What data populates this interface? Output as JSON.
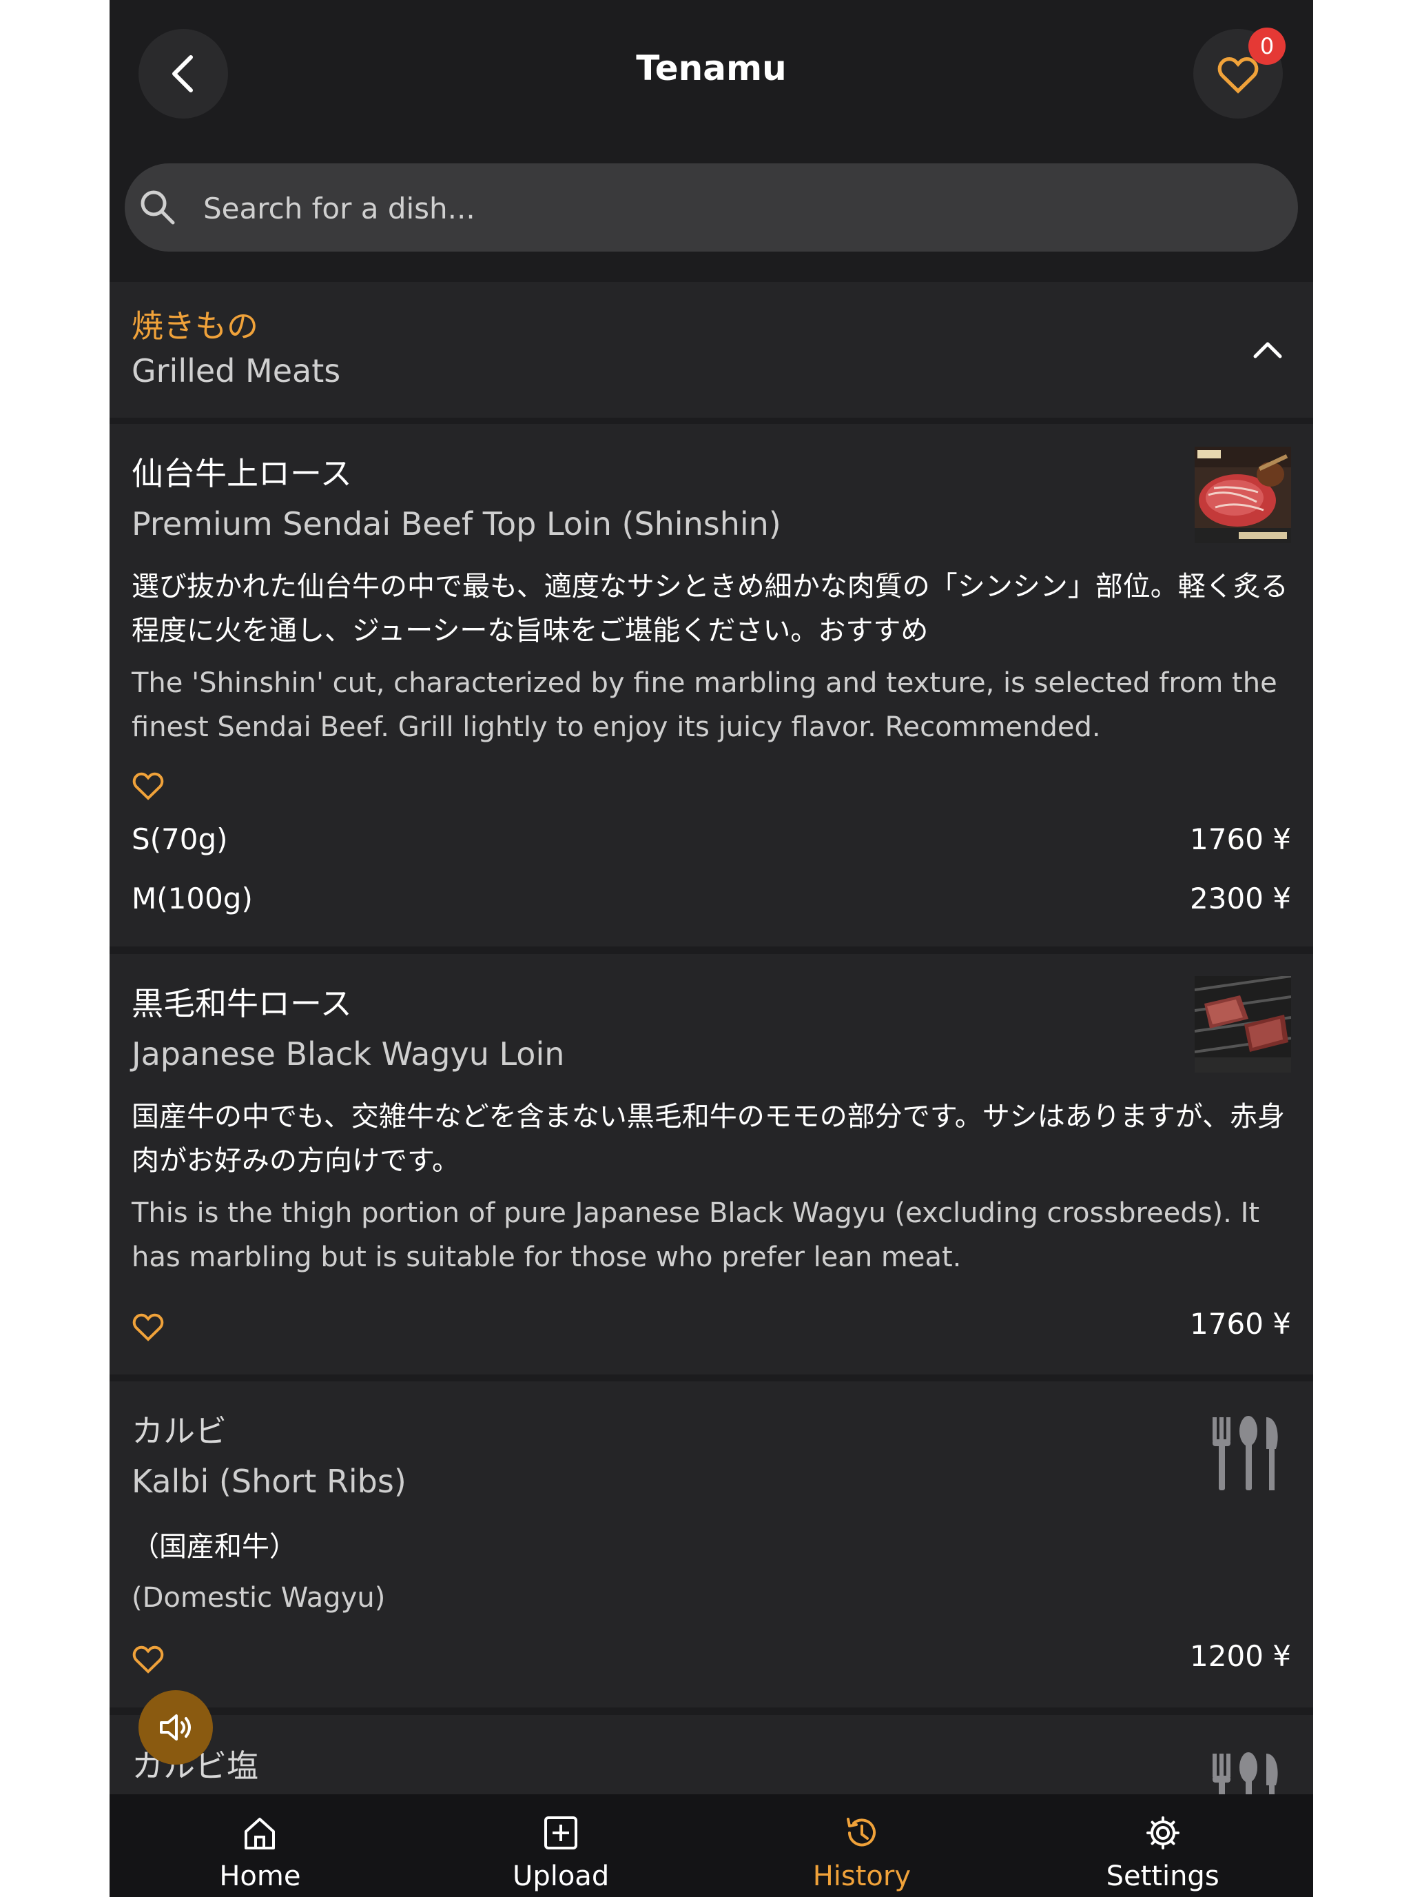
{
  "header": {
    "title": "Tenamu",
    "favorites_count": "0"
  },
  "search": {
    "placeholder": "Search for a dish..."
  },
  "category": {
    "name_jp": "焼きもの",
    "name_en": "Grilled Meats"
  },
  "items": [
    {
      "name_jp": "仙台牛上ロース",
      "name_en": "Premium Sendai Beef Top Loin (Shinshin)",
      "desc_jp": "選び抜かれた仙台牛の中で最も、適度なサシときめ細かな肉質の「シンシン」部位。軽く炙る程度に火を通し、ジューシーな旨味をご堪能ください。おすすめ",
      "desc_en": "The 'Shinshin' cut, characterized by fine marbling and texture, is selected from the finest Sendai Beef. Grill lightly to enjoy its juicy flavor. Recommended.",
      "image": "sendai-beef-photo",
      "prices": [
        {
          "label": "S(70g)",
          "price": "1760 ¥"
        },
        {
          "label": "M(100g)",
          "price": "2300 ¥"
        }
      ]
    },
    {
      "name_jp": "黒毛和牛ロース",
      "name_en": "Japanese Black Wagyu Loin",
      "desc_jp": "国産牛の中でも、交雑牛などを含まない黒毛和牛のモモの部分です。サシはありますが、赤身肉がお好みの方向けです。",
      "desc_en": "This is the thigh portion of pure Japanese Black Wagyu (excluding crossbreeds). It has marbling but is suitable for those who prefer lean meat.",
      "image": "wagyu-grill-photo",
      "prices": [
        {
          "label": "",
          "price": "1760 ¥"
        }
      ]
    },
    {
      "name_jp": "カルビ",
      "name_en": "Kalbi (Short Ribs)",
      "desc_jp": "（国産和牛）",
      "desc_en": "(Domestic Wagyu)",
      "image": "utensils-icon",
      "prices": [
        {
          "label": "",
          "price": "1200 ¥"
        }
      ]
    },
    {
      "name_jp": "カルビ塩",
      "image": "utensils-icon"
    }
  ],
  "nav": [
    {
      "label": "Home",
      "icon": "home-icon"
    },
    {
      "label": "Upload",
      "icon": "upload-icon"
    },
    {
      "label": "History",
      "icon": "history-icon",
      "active": true
    },
    {
      "label": "Settings",
      "icon": "settings-icon"
    }
  ],
  "colors": {
    "accent": "#f0a23a",
    "background": "#1c1c1e",
    "card": "#252527",
    "badge": "#e53935"
  }
}
